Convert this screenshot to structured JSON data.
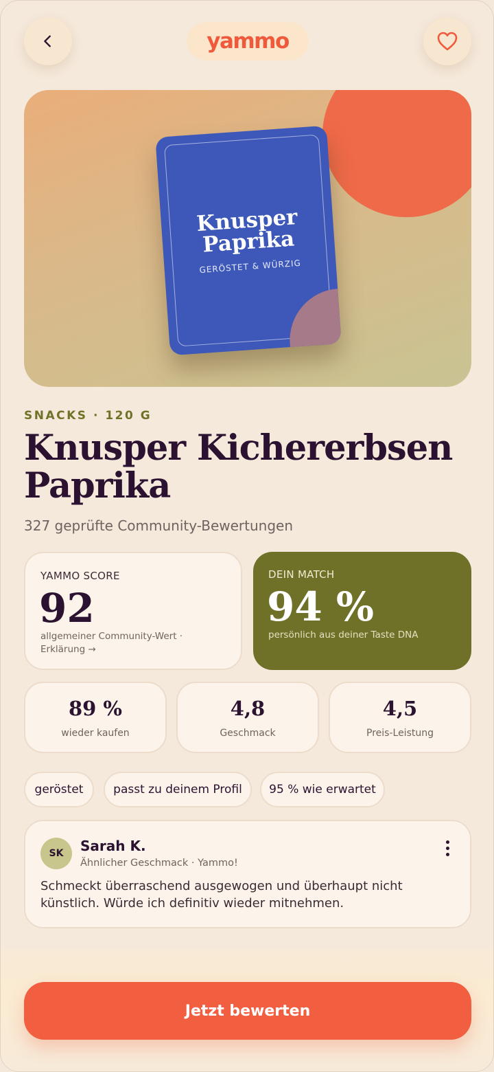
{
  "brand": {
    "logo": "yammo",
    "color": "#ef5a3c"
  },
  "header": {
    "back_icon": "chevron-left-icon",
    "favorite_icon": "heart-icon"
  },
  "hero": {
    "pack_title_line1": "Knusper",
    "pack_title_line2": "Paprika",
    "pack_subtitle": "GERÖSTET & WÜRZIG",
    "pack_color": "#3d58b8"
  },
  "product": {
    "meta": "SNACKS · 120 G",
    "title": "Knusper Kichererbsen Paprika",
    "reviews": "327 geprüfte Community-Bewertungen"
  },
  "score": {
    "label": "YAMMO SCORE",
    "value": "92",
    "note": "allgemeiner Community-Wert · Erklärung →"
  },
  "match": {
    "label": "DEIN MATCH",
    "value": "94 %",
    "note": "persönlich aus deiner Taste DNA",
    "color": "#6f7129"
  },
  "stats": [
    {
      "value": "89 %",
      "label": "wieder kaufen"
    },
    {
      "value": "4,8",
      "label": "Geschmack"
    },
    {
      "value": "4,5",
      "label": "Preis-Leistung"
    }
  ],
  "tags": [
    "geröstet",
    "passt zu deinem Profil",
    "95 % wie erwartet"
  ],
  "review": {
    "initials": "SK",
    "name": "Sarah K.",
    "subtitle": "Ähnlicher Geschmack · Yammo!",
    "text": "Schmeckt überraschend ausgewogen und überhaupt nicht künstlich. Würde ich definitiv wieder mitnehmen."
  },
  "cta": {
    "label": "Jetzt bewerten",
    "color": "#f15e40"
  }
}
